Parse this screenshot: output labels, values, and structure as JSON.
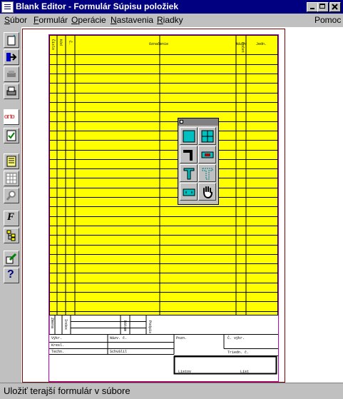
{
  "window": {
    "title": "Blank Editor - Formulár Súpisu položiek"
  },
  "menu": {
    "items": [
      {
        "label": "Súbor",
        "accel": "S",
        "rest": "úbor"
      },
      {
        "label": "Formulár",
        "accel": "F",
        "rest": "ormulár"
      },
      {
        "label": "Operácie",
        "accel": "O",
        "rest": "perácie"
      },
      {
        "label": "Nastavenia",
        "accel": "N",
        "rest": "astavenia"
      },
      {
        "label": "Riadky",
        "accel": "R",
        "rest": "iadky"
      },
      {
        "label": "Pomoc",
        "accel": "",
        "rest": "Pomoc"
      }
    ]
  },
  "toolbar": {
    "icons": [
      "new-form-icon",
      "export-icon",
      "print-preview-icon",
      "print-icon",
      "text-style-icon",
      "checklist-icon",
      "document-icon",
      "grid-icon",
      "zoom-icon",
      "font-icon",
      "tree-icon",
      "edit-icon",
      "help-icon"
    ],
    "text_style_label": "or to"
  },
  "form": {
    "columns": [
      "Číslo",
      "Kód",
      "Č.",
      "Označenie",
      "Názov",
      "Počet",
      "Jedn."
    ],
    "footer": {
      "cells": [
        "Výkr.",
        "Názv. č.",
        "Pozn.",
        "Č. výkr.",
        "Kresl.",
        "Techn.",
        "Schválil",
        "Triedn. č.",
        "Listov",
        "List"
      ],
      "side": [
        "Zmena",
        "Index",
        "Dátum",
        "Podpis"
      ]
    }
  },
  "palette": {
    "tools": [
      "rectangle-icon",
      "grid-table-icon",
      "step-line-icon",
      "field-icon",
      "text-icon",
      "text-dashed-icon",
      "label-field-icon",
      "hand-icon"
    ]
  },
  "status": {
    "text": "Uložiť terajší formulár v súbore"
  },
  "colors": {
    "title_bar": "#000080",
    "table_fill": "#ffff00",
    "form_border": "#c000c0",
    "page_frame": "#800000"
  }
}
